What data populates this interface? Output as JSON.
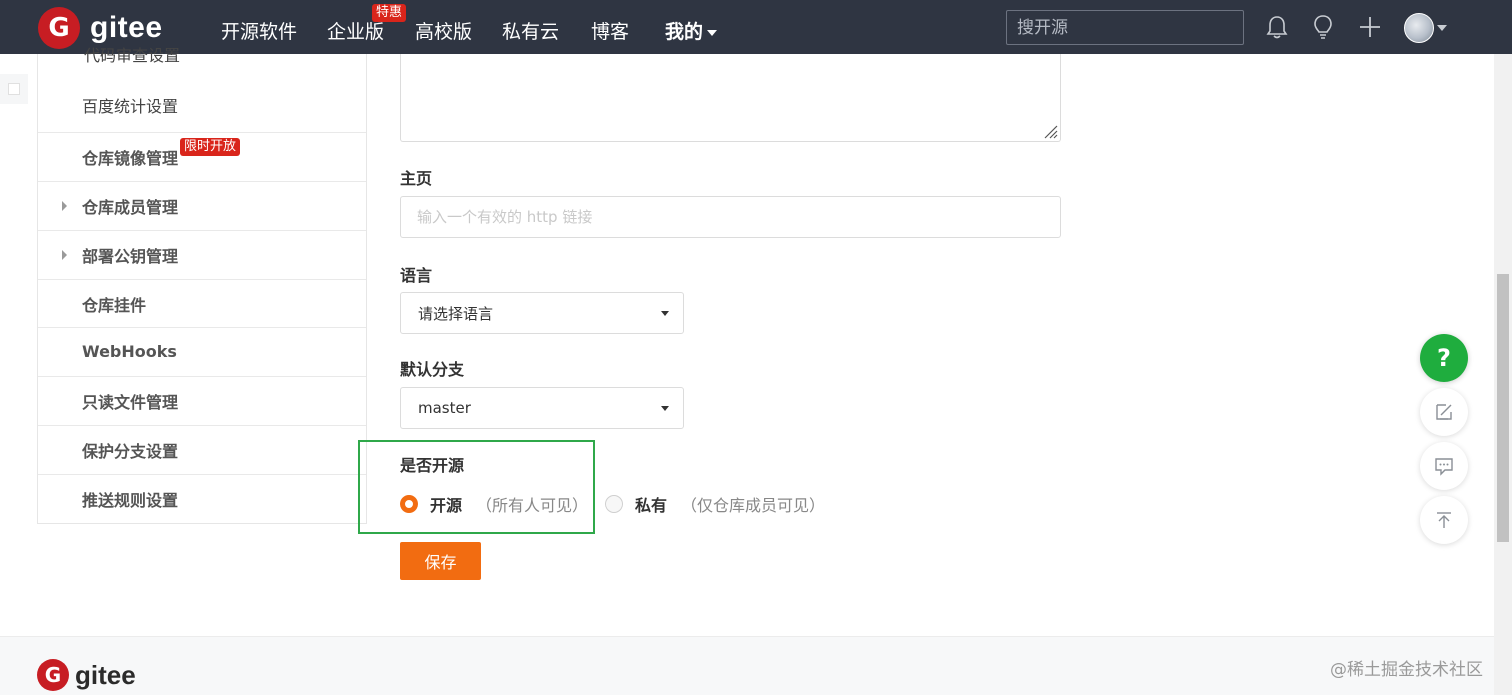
{
  "header": {
    "logo_letter": "G",
    "brand": "gitee",
    "nav": [
      "开源软件",
      "企业版",
      "高校版",
      "私有云",
      "博客",
      "我的"
    ],
    "hot_badge": "特惠",
    "search_placeholder": "搜开源",
    "icons": [
      "bell-icon",
      "lightbulb-icon",
      "plus-icon"
    ]
  },
  "sidebar": {
    "partial_item": "代码审查设置",
    "items": [
      {
        "label": "百度统计设置",
        "bold": false,
        "expandable": false
      },
      {
        "label": "仓库镜像管理",
        "bold": true,
        "expandable": false,
        "badge": "限时开放"
      },
      {
        "label": "仓库成员管理",
        "bold": true,
        "expandable": true
      },
      {
        "label": "部署公钥管理",
        "bold": true,
        "expandable": true
      },
      {
        "label": "仓库挂件",
        "bold": true,
        "expandable": false
      },
      {
        "label": "WebHooks",
        "bold": true,
        "expandable": false
      },
      {
        "label": "只读文件管理",
        "bold": true,
        "expandable": false
      },
      {
        "label": "保护分支设置",
        "bold": true,
        "expandable": false
      },
      {
        "label": "推送规则设置",
        "bold": true,
        "expandable": false
      }
    ]
  },
  "form": {
    "homepage_label": "主页",
    "homepage_placeholder": "输入一个有效的 http 链接",
    "language_label": "语言",
    "language_value": "请选择语言",
    "branch_label": "默认分支",
    "branch_value": "master",
    "visibility_label": "是否开源",
    "visibility_options": [
      {
        "label": "开源",
        "note": "（所有人可见）",
        "selected": true
      },
      {
        "label": "私有",
        "note": "（仅仓库成员可见）",
        "selected": false
      }
    ],
    "save_label": "保存"
  },
  "floating": {
    "help_label": "?",
    "icons": [
      "edit-icon",
      "comment-icon",
      "back-to-top-icon"
    ]
  },
  "footer": {
    "logo_letter": "G",
    "brand": "gitee",
    "watermark": "@稀土掘金技术社区"
  },
  "colors": {
    "nav_bg": "#2f3542",
    "brand_red": "#c71d23",
    "accent_orange": "#f26c11",
    "help_green": "#1fad3e",
    "highlight_green": "#2fa84a"
  }
}
